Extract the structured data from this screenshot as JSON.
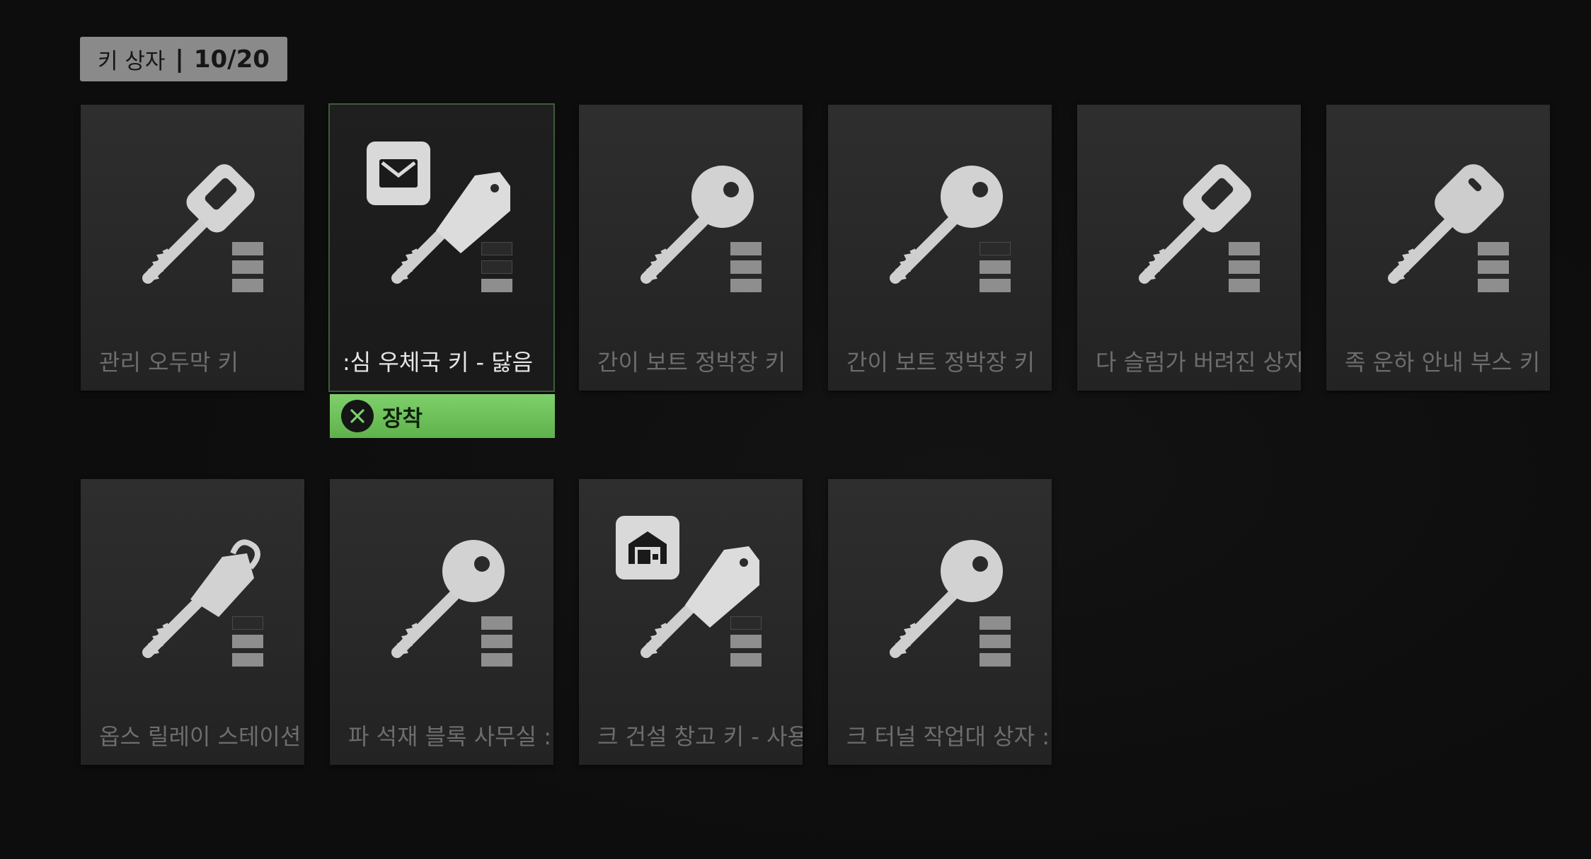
{
  "header": {
    "title": "키 상자",
    "separator": "|",
    "count": "10/20"
  },
  "slots": [
    {
      "label": "관리 오두막 키",
      "icon": "key-rectangular-bow-icon",
      "bars": [
        1,
        1,
        1
      ],
      "selected": false
    },
    {
      "label": ":심 우체국 키 - 닳음",
      "icon": "key-tag-icon",
      "badge": "mail-icon",
      "bars": [
        0,
        0,
        1
      ],
      "selected": true
    },
    {
      "label": "간이 보트 정박장 키",
      "icon": "key-round-bow-icon",
      "bars": [
        1,
        1,
        1
      ],
      "selected": false
    },
    {
      "label": "간이 보트 정박장 키",
      "icon": "key-round-bow-icon",
      "bars": [
        0,
        1,
        1
      ],
      "selected": false
    },
    {
      "label": "다 슬럼가 버려진 상자",
      "icon": "key-rectangular-bow-icon",
      "bars": [
        1,
        1,
        1
      ],
      "selected": false
    },
    {
      "label": "족 운하 안내 부스 키",
      "icon": "key-oval-bow-icon",
      "bars": [
        1,
        1,
        1
      ],
      "selected": false
    },
    {
      "label": "옵스 릴레이 스테이션",
      "icon": "key-padlock-bow-icon",
      "bars": [
        0,
        1,
        1
      ],
      "selected": false
    },
    {
      "label": "파 석재 블록 사무실 :",
      "icon": "key-round-bow-icon",
      "bars": [
        1,
        1,
        1
      ],
      "selected": false
    },
    {
      "label": "크 건설 창고 키 - 사용",
      "icon": "key-tag-icon",
      "badge": "garage-icon",
      "bars": [
        0,
        1,
        1
      ],
      "selected": false
    },
    {
      "label": "크 터널 작업대 상자 :",
      "icon": "key-round-bow-icon",
      "bars": [
        1,
        1,
        1
      ],
      "selected": false
    }
  ],
  "equip": {
    "button_icon": "x-button-icon",
    "label": "장착"
  },
  "colors": {
    "equip_green": "#6cc258",
    "panel": "#2b2b2b",
    "background": "#0d0d0d"
  }
}
